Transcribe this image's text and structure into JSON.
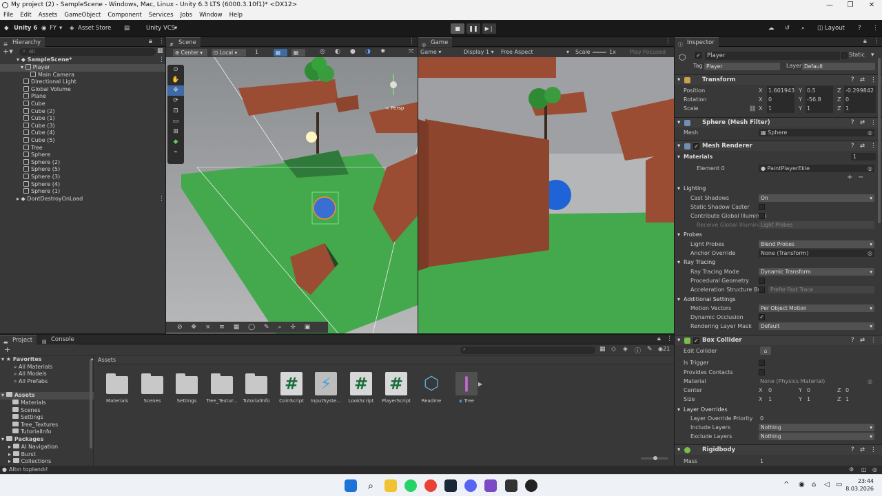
{
  "titlebar": {
    "title": "My project (2) - SampleScene - Windows, Mac, Linux - Unity 6.3 LTS (6000.3.10f1)* <DX12>"
  },
  "menu": [
    "File",
    "Edit",
    "Assets",
    "GameObject",
    "Component",
    "Services",
    "Jobs",
    "Window",
    "Help"
  ],
  "toolbar": {
    "unity": "Unity 6",
    "account": "FY",
    "asset_store": "Asset Store",
    "vcs": "Unity VCS",
    "layout": "Layout"
  },
  "hierarchy": {
    "tab": "Hierarchy",
    "search_placeholder": "All",
    "scene": "SampleScene*",
    "items": [
      "Player",
      "Main Camera",
      "Directional Light",
      "Global Volume",
      "Plane",
      "Cube",
      "Cube (2)",
      "Cube (1)",
      "Cube (3)",
      "Cube (4)",
      "Cube (5)",
      "Tree",
      "Sphere",
      "Sphere (2)",
      "Sphere (5)",
      "Sphere (3)",
      "Sphere (4)",
      "Sphere (1)"
    ],
    "ddol": "DontDestroyOnLoad"
  },
  "scene": {
    "tab": "Scene",
    "pivot": "Center",
    "space": "Local",
    "snap": "1",
    "persp": "< Persp"
  },
  "game": {
    "tab": "Game",
    "mode": "Game",
    "display": "Display 1",
    "aspect": "Free Aspect",
    "scale_label": "Scale",
    "scale_value": "1x",
    "play_focused": "Play Focused"
  },
  "inspector": {
    "tab": "Inspector",
    "name": "Player",
    "static": "Static",
    "tag_label": "Tag",
    "tag": "Player",
    "layer_label": "Layer",
    "layer": "Default",
    "transform": {
      "title": "Transform",
      "position": {
        "label": "Position",
        "x": "1.601943",
        "y": "0.5",
        "z": "-0.299842"
      },
      "rotation": {
        "label": "Rotation",
        "x": "0",
        "y": "-56.8",
        "z": "0"
      },
      "scale": {
        "label": "Scale",
        "x": "1",
        "y": "1",
        "z": "1"
      }
    },
    "mesh_filter": {
      "title": "Sphere (Mesh Filter)",
      "mesh_label": "Mesh",
      "mesh": "Sphere"
    },
    "mesh_renderer": {
      "title": "Mesh Renderer",
      "materials": "Materials",
      "materials_count": "1",
      "element0": "Element 0",
      "element0_value": "PaintPlayerEkle",
      "lighting": "Lighting",
      "cast_shadows": "Cast Shadows",
      "cast_shadows_value": "On",
      "static_shadow": "Static Shadow Caster",
      "contribute_gi": "Contribute Global Illuminati",
      "receive_gi": "Receive Global Illuminat",
      "receive_gi_value": "Light Probes",
      "probes": "Probes",
      "light_probes": "Light Probes",
      "light_probes_value": "Blend Probes",
      "anchor": "Anchor Override",
      "anchor_value": "None (Transform)",
      "ray_tracing": "Ray Tracing",
      "rt_mode": "Ray Tracing Mode",
      "rt_mode_value": "Dynamic Transform",
      "proc_geo": "Procedural Geometry",
      "accel": "Acceleration Structure Bui",
      "accel_value": "Prefer Fast Trace",
      "additional": "Additional Settings",
      "motion_vectors": "Motion Vectors",
      "motion_vectors_value": "Per Object Motion",
      "dyn_occ": "Dynamic Occlusion",
      "rlm": "Rendering Layer Mask",
      "rlm_value": "Default"
    },
    "box_collider": {
      "title": "Box Collider",
      "edit": "Edit Collider",
      "trigger": "Is Trigger",
      "contacts": "Provides Contacts",
      "material": "Material",
      "material_value": "None (Physics Material)",
      "center": {
        "label": "Center",
        "x": "0",
        "y": "0",
        "z": "0"
      },
      "size": {
        "label": "Size",
        "x": "1",
        "y": "1",
        "z": "1"
      },
      "layer_overrides": "Layer Overrides",
      "priority": "Layer Override Priority",
      "priority_value": "0",
      "include": "Include Layers",
      "include_value": "Nothing",
      "exclude": "Exclude Layers",
      "exclude_value": "Nothing"
    },
    "rigidbody": {
      "title": "Rigidbody",
      "mass": "Mass",
      "mass_value": "1"
    }
  },
  "project": {
    "tab_project": "Project",
    "tab_console": "Console",
    "count": "21",
    "favorites": "Favorites",
    "fav_items": [
      "All Materials",
      "All Models",
      "All Prefabs"
    ],
    "assets_root": "Assets",
    "asset_folders": [
      "Materials",
      "Scenes",
      "Settings",
      "Tree_Textures",
      "TutorialInfo"
    ],
    "packages": "Packages",
    "package_items": [
      "AI Navigation",
      "Burst",
      "Collections"
    ],
    "breadcrumb": "Assets",
    "assets": [
      "Materials",
      "Scenes",
      "Settings",
      "Tree_Textur...",
      "TutorialInfo",
      "CoinScript",
      "InputSyste...",
      "LookScript",
      "PlayerScript",
      "Readme",
      "Tree"
    ]
  },
  "status": "Altın toplandı!",
  "clock": {
    "time": "23:44",
    "date": "8.03.2026"
  }
}
